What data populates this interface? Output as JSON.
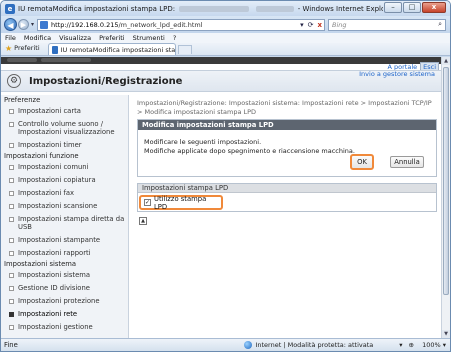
{
  "window": {
    "title_prefix": "IU remotaModifica impostazioni stampa LPD:",
    "title_suffix": "- Windows Internet Explorer",
    "buttons": {
      "minimize": "–",
      "maximize": "□",
      "close": "x"
    }
  },
  "addressbar": {
    "url_domain": "http://192.168.0.215",
    "url_path": "/m_network_lpd_edit.html",
    "search_placeholder": "Bing",
    "refresh": "⟳",
    "stop": "x",
    "back": "◀",
    "forward": "▶",
    "dropdown": "▾",
    "search_icon": "⌕"
  },
  "menubar": [
    "File",
    "Modifica",
    "Visualizza",
    "Preferiti",
    "Strumenti",
    "?"
  ],
  "favbar": {
    "favorites_label": "Preferiti",
    "tab_label": "IU remotaModifica impostazioni stampa LPD:..."
  },
  "page": {
    "portal_link": "A portale",
    "exit_button": "Esci",
    "title": "Impostazioni/Registrazione",
    "send_to_manager": "Invio a gestore sistema",
    "breadcrumb": "Impostazioni/Registrazione: Impostazioni sistema: Impostazioni rete > Impostazioni TCP/IP > Modifica impostazioni stampa LPD"
  },
  "sidebar": {
    "sections": [
      {
        "title": "Preferenze",
        "items": [
          "Impostazioni carta",
          "Controllo volume suono / Impostazioni visualizzazione",
          "Impostazioni timer"
        ]
      },
      {
        "title": "Impostazioni funzione",
        "items": [
          "Impostazioni comuni",
          "Impostazioni copiatura",
          "Impostazioni fax",
          "Impostazioni scansione",
          "Impostazioni stampa diretta da USB",
          "Impostazioni stampante",
          "Impostazioni rapporti"
        ]
      },
      {
        "title": "Impostazioni sistema",
        "items": [
          "Impostazioni sistema",
          "Gestione ID divisione",
          "Impostazioni protezione",
          "Impostazioni rete",
          "Impostazioni gestione"
        ]
      }
    ]
  },
  "modify_box": {
    "header": "Modifica impostazioni stampa LPD",
    "line1": "Modificare le seguenti impostazioni.",
    "line2": "Modifiche applicate dopo spegnimento e riaccensione macchina.",
    "ok": "OK",
    "cancel": "Annulla"
  },
  "settings_box": {
    "header": "Impostazioni stampa LPD",
    "checkbox_label": "Utilizzo stampa LPD",
    "checkbox_checked": true,
    "check_glyph": "✓"
  },
  "statusbar": {
    "left": "Fine",
    "zone": "Internet | Modalità protetta: attivata",
    "zoom": "100%",
    "tools": "▾"
  },
  "icons": {
    "gear": "⚙",
    "star": "★",
    "top": "▲"
  }
}
